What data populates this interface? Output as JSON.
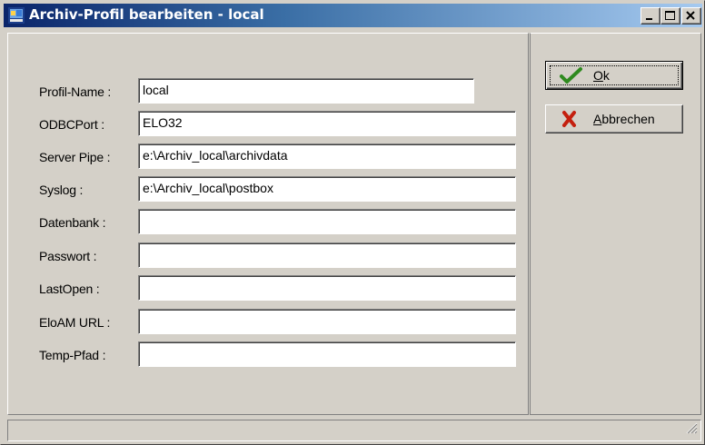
{
  "window": {
    "title": "Archiv-Profil bearbeiten - local",
    "icon": "elo-archive-icon",
    "controls": [
      "minimize-icon",
      "maximize-icon",
      "close-icon"
    ]
  },
  "form": {
    "fields": [
      {
        "label": "Profil-Name :",
        "value": "local"
      },
      {
        "label": "ODBCPort :",
        "value": "ELO32"
      },
      {
        "label": "Server Pipe :",
        "value": "e:\\Archiv_local\\archivdata"
      },
      {
        "label": "Syslog :",
        "value": "e:\\Archiv_local\\postbox"
      },
      {
        "label": "Datenbank :",
        "value": ""
      },
      {
        "label": "Passwort :",
        "value": ""
      },
      {
        "label": "LastOpen :",
        "value": ""
      },
      {
        "label": "EloAM URL :",
        "value": ""
      },
      {
        "label": "Temp-Pfad :",
        "value": ""
      }
    ]
  },
  "buttons": {
    "ok": {
      "mnemonic": "O",
      "rest": "k",
      "icon": "checkmark-icon",
      "color": "#2f8a1f"
    },
    "cancel": {
      "mnemonic": "A",
      "rest": "bbrechen",
      "icon": "red-x-icon",
      "color": "#c41f0e"
    }
  },
  "colors": {
    "face": "#d4d0c8",
    "title_start": "#0a246a",
    "title_end": "#a6caf0"
  }
}
